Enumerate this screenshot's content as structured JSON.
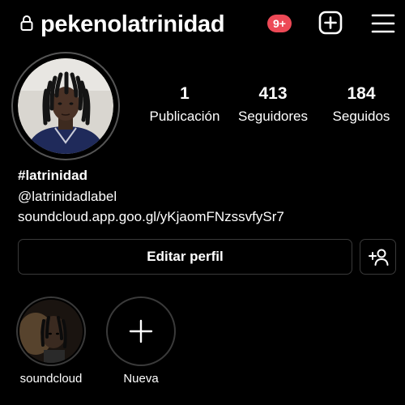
{
  "header": {
    "username": "pekenolatrinidad",
    "notification_badge": "9+",
    "icons": [
      "lock-icon",
      "new-post-icon",
      "menu-icon"
    ],
    "badge_color": "#ed4956"
  },
  "stats": [
    {
      "value": "1",
      "label": "Publicación"
    },
    {
      "value": "413",
      "label": "Seguidores"
    },
    {
      "value": "184",
      "label": "Seguidos"
    }
  ],
  "bio": {
    "name": "#latrinidad",
    "handle": "@latrinidadlabel",
    "link": "soundcloud.app.goo.gl/yKjaomFNzssvfySr7"
  },
  "actions": {
    "edit_profile": "Editar perfil",
    "add_user_icon": "add-person-icon"
  },
  "highlights": [
    {
      "label": "soundcloud"
    },
    {
      "label": "Nueva"
    }
  ]
}
